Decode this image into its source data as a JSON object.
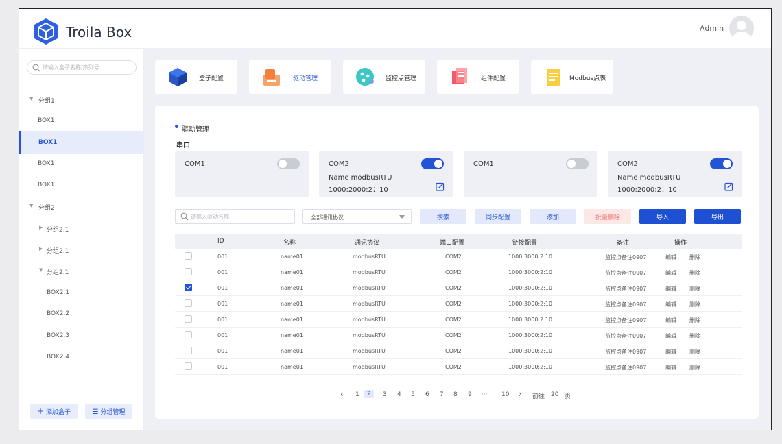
{
  "app": {
    "title": "Troila Box",
    "user": "Admin",
    "brand_color": "#2454d6"
  },
  "sidebar": {
    "search_placeholder": "请输入盒子名称/序列号",
    "tree": [
      {
        "label": "分组1",
        "type": "group",
        "expanded": true
      },
      {
        "label": "BOX1",
        "type": "leaf"
      },
      {
        "label": "BOX1",
        "type": "leaf",
        "active": true
      },
      {
        "label": "BOX1",
        "type": "leaf"
      },
      {
        "label": "BOX1",
        "type": "leaf"
      },
      {
        "label": "分组2",
        "type": "group",
        "expanded": true
      },
      {
        "label": "分组2.1",
        "type": "subgroup",
        "expanded": false
      },
      {
        "label": "分组2.1",
        "type": "subgroup",
        "expanded": false
      },
      {
        "label": "分组2.1",
        "type": "subgroup",
        "expanded": true
      },
      {
        "label": "BOX2.1",
        "type": "subleaf"
      },
      {
        "label": "BOX2.2",
        "type": "subleaf"
      },
      {
        "label": "BOX2.3",
        "type": "subleaf"
      },
      {
        "label": "BOX2.4",
        "type": "subleaf"
      }
    ],
    "add_box": "添加盒子",
    "group_manage": "分组管理"
  },
  "nav_cards": [
    {
      "label": "盒子配置",
      "icon": "cube-icon"
    },
    {
      "label": "驱动管理",
      "icon": "driver-icon",
      "active": true
    },
    {
      "label": "监控点管理",
      "icon": "monitor-point-icon"
    },
    {
      "label": "组件配置",
      "icon": "component-icon"
    },
    {
      "label": "Modbus点表",
      "icon": "modbus-table-icon"
    }
  ],
  "driver": {
    "section_title": "驱动管理",
    "serial_title": "串口",
    "ports": [
      {
        "name": "COM1",
        "enabled": false
      },
      {
        "name": "COM2",
        "enabled": true,
        "line1": "Name   modbusRTU",
        "line2": "1000:2000:2：10"
      },
      {
        "name": "COM1",
        "enabled": false
      },
      {
        "name": "COM2",
        "enabled": true,
        "line1": "Name   modbusRTU",
        "line2": "1000:2000:2：10"
      }
    ]
  },
  "toolbar": {
    "search_placeholder": "请输入驱动名称",
    "protocol_select": "全部通讯协议",
    "search": "搜索",
    "sync": "同步配置",
    "add": "添加",
    "batch_delete": "批量删除",
    "import": "导入",
    "export": "导出"
  },
  "table": {
    "headers": {
      "id": "ID",
      "name": "名称",
      "protocol": "通讯协议",
      "port": "端口配置",
      "link": "链接配置",
      "remark": "备注",
      "ops": "操作"
    },
    "edit": "编辑",
    "delete": "删除",
    "rows": [
      {
        "checked": false,
        "id": "001",
        "name": "name01",
        "protocol": "modbusRTU",
        "port": "COM2",
        "link": "1000:3000:2:10",
        "remark": "监控点备注0907"
      },
      {
        "checked": false,
        "id": "001",
        "name": "name01",
        "protocol": "modbusRTU",
        "port": "COM2",
        "link": "1000:3000:2:10",
        "remark": "监控点备注0907"
      },
      {
        "checked": true,
        "id": "001",
        "name": "name01",
        "protocol": "modbusRTU",
        "port": "COM2",
        "link": "1000:3000:2:10",
        "remark": "监控点备注0907"
      },
      {
        "checked": false,
        "id": "001",
        "name": "name01",
        "protocol": "modbusRTU",
        "port": "COM2",
        "link": "1000:3000:2:10",
        "remark": "监控点备注0907"
      },
      {
        "checked": false,
        "id": "001",
        "name": "name01",
        "protocol": "modbusRTU",
        "port": "COM2",
        "link": "1000:3000:2:10",
        "remark": "监控点备注0907"
      },
      {
        "checked": false,
        "id": "001",
        "name": "name01",
        "protocol": "modbusRTU",
        "port": "COM2",
        "link": "1000:3000:2:10",
        "remark": "监控点备注0907"
      },
      {
        "checked": false,
        "id": "001",
        "name": "name01",
        "protocol": "modbusRTU",
        "port": "COM2",
        "link": "1000:3000:2:10",
        "remark": "监控点备注0907"
      },
      {
        "checked": false,
        "id": "001",
        "name": "name01",
        "protocol": "modbusRTU",
        "port": "COM2",
        "link": "1000:3000:2:10",
        "remark": "监控点备注0907"
      }
    ]
  },
  "pagination": {
    "pages": [
      "1",
      "2",
      "3",
      "4",
      "5",
      "6",
      "7",
      "8",
      "9"
    ],
    "current": "2",
    "ellipsis": "···",
    "last": "10",
    "goto_label": "前往",
    "goto_value": "20",
    "page_unit": "页"
  }
}
